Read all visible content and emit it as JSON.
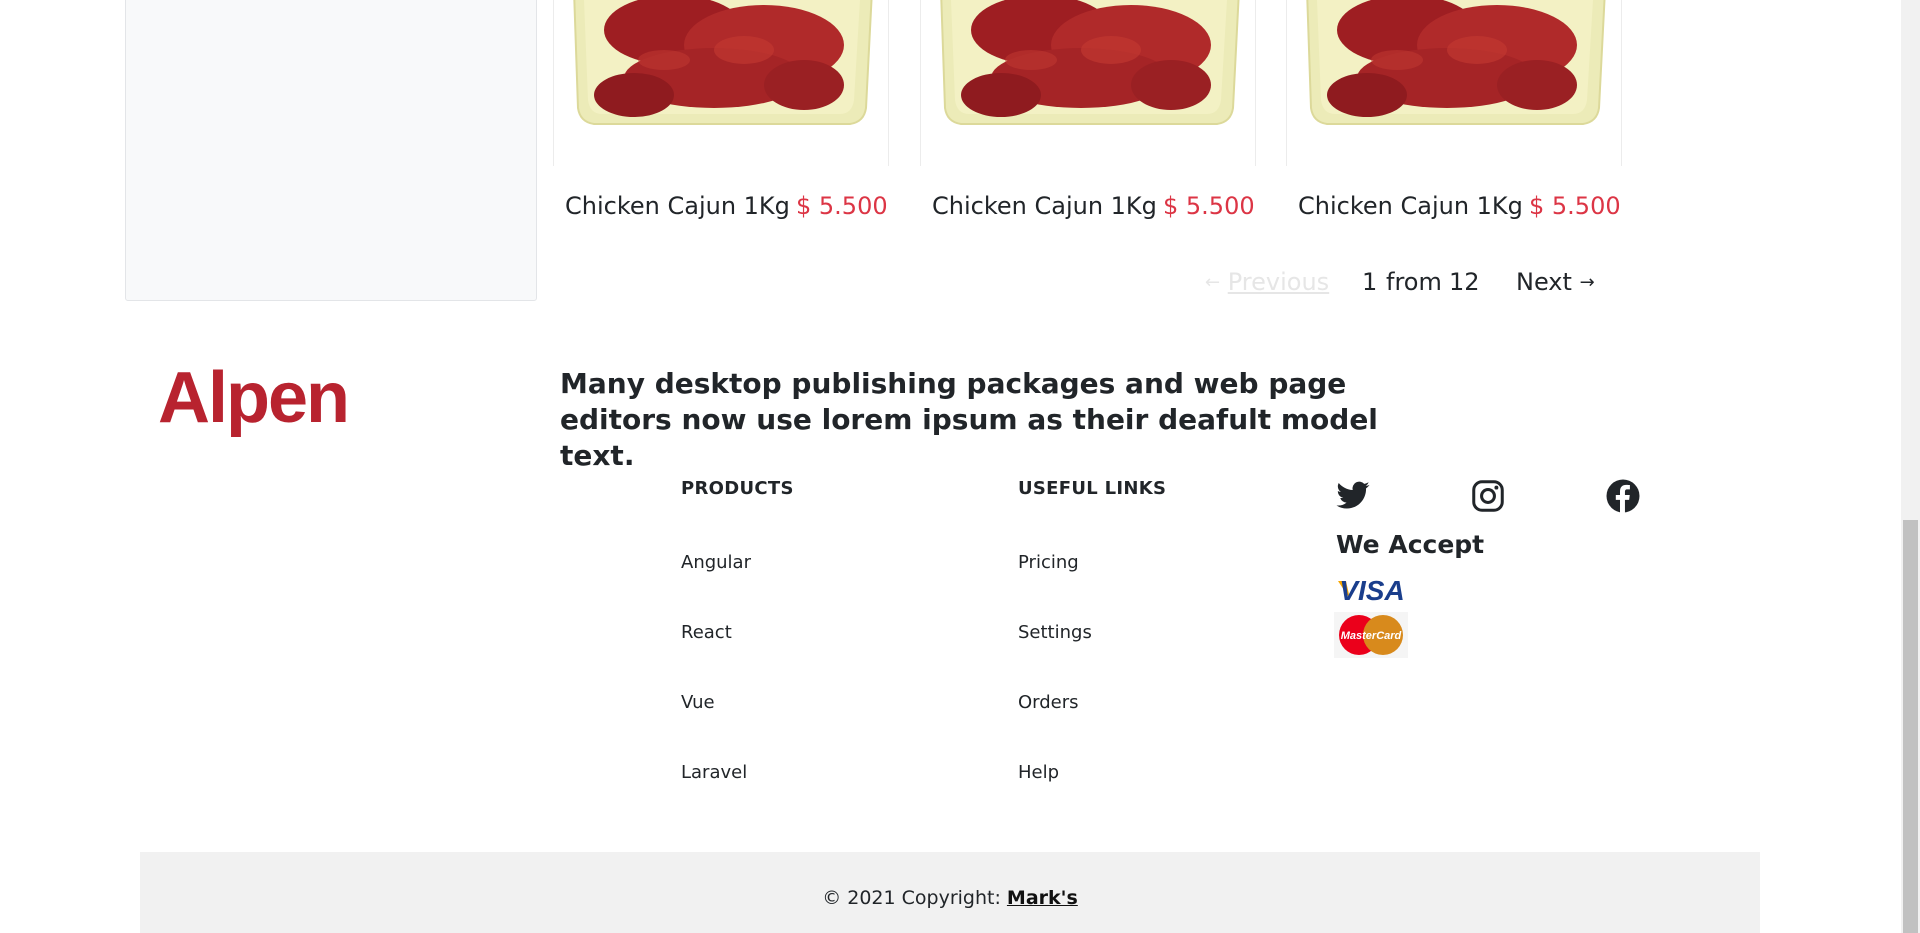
{
  "products": [
    {
      "name": "Chicken Cajun 1Kg",
      "price": "$ 5.500",
      "image_icon": "chicken-cajun-photo"
    },
    {
      "name": "Chicken Cajun 1Kg",
      "price": "$ 5.500",
      "image_icon": "chicken-cajun-photo"
    },
    {
      "name": "Chicken Cajun 1Kg",
      "price": "$ 5.500",
      "image_icon": "chicken-cajun-photo"
    }
  ],
  "pagination": {
    "previous_arrow": "←",
    "previous_label": "Previous",
    "current_page": "1",
    "from_label": "from",
    "total_pages": "12",
    "next_label": "Next",
    "next_arrow": "→"
  },
  "footer": {
    "brand": "Alpen",
    "brand_color": "#b8232f",
    "tagline": "Many desktop publishing packages and web page editors now use lorem ipsum as their deafult model text.",
    "products_heading": "PRODUCTS",
    "products_links": [
      "Angular",
      "React",
      "Vue",
      "Laravel"
    ],
    "useful_heading": "USEFUL LINKS",
    "useful_links": [
      "Pricing",
      "Settings",
      "Orders",
      "Help"
    ],
    "social_icons": [
      "twitter-icon",
      "instagram-icon",
      "facebook-icon"
    ],
    "we_accept": "We Accept",
    "payment_visa": "VISA",
    "payment_mastercard": "MasterCard"
  },
  "copyright": {
    "prefix": "© 2021 Copyright: ",
    "owner": "Mark's"
  },
  "colors": {
    "price": "#dc3545",
    "footer_bar": "#f1f1f1"
  }
}
